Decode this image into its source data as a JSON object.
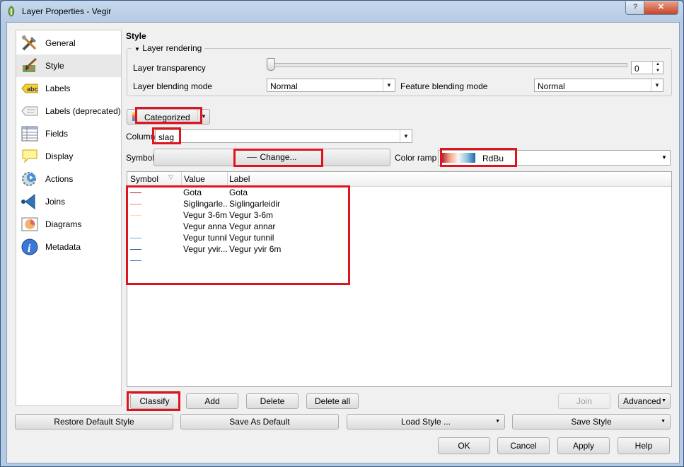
{
  "window": {
    "title": "Layer Properties - Vegir",
    "help_label": "?",
    "close_label": "✕"
  },
  "sidebar": {
    "items": [
      {
        "label": "General",
        "icon": "tools-icon"
      },
      {
        "label": "Style",
        "icon": "paintbrush-icon"
      },
      {
        "label": "Labels",
        "icon": "abc-icon"
      },
      {
        "label": "Labels (deprecated)",
        "icon": "label-deprecated-icon"
      },
      {
        "label": "Fields",
        "icon": "table-icon"
      },
      {
        "label": "Display",
        "icon": "speech-bubble-icon"
      },
      {
        "label": "Actions",
        "icon": "gear-play-icon"
      },
      {
        "label": "Joins",
        "icon": "join-arrow-icon"
      },
      {
        "label": "Diagrams",
        "icon": "chart-icon"
      },
      {
        "label": "Metadata",
        "icon": "info-icon"
      }
    ],
    "selected": "Style"
  },
  "style": {
    "heading": "Style",
    "rendering_group": "Layer rendering",
    "transparency_label": "Layer transparency",
    "transparency_value": "0",
    "transparency_level": 0,
    "layer_blending_label": "Layer blending mode",
    "layer_blending_value": "Normal",
    "feature_blending_label": "Feature blending mode",
    "feature_blending_value": "Normal",
    "renderer": "Categorized",
    "column_label": "Column",
    "column_value": "slag",
    "symbol_label": "Symbol",
    "change_label": "Change...",
    "color_ramp_label": "Color ramp",
    "color_ramp_value": "RdBu"
  },
  "table": {
    "headers": [
      "Symbol",
      "Value",
      "Label"
    ],
    "rows": [
      {
        "color": "#b2182b",
        "value": "Gota",
        "label": "Gota"
      },
      {
        "color": "#ef8a62",
        "value": "Siglingarle...",
        "label": "Siglingarleidir"
      },
      {
        "color": "#fddbc7",
        "value": "Vegur 3-6m",
        "label": "Vegur 3-6m"
      },
      {
        "color": "#f7f7f7",
        "value": "Vegur annar",
        "label": "Vegur annar"
      },
      {
        "color": "#67a9cf",
        "value": "Vegur tunnil",
        "label": "Vegur tunnil"
      },
      {
        "color": "#2166ac",
        "value": "Vegur yvir...",
        "label": "Vegur yvir 6m"
      },
      {
        "color": "#2166ac",
        "value": "",
        "label": ""
      }
    ]
  },
  "buttons": {
    "classify": "Classify",
    "add": "Add",
    "delete": "Delete",
    "delete_all": "Delete all",
    "join": "Join",
    "advanced": "Advanced",
    "restore_default": "Restore Default Style",
    "save_default": "Save As Default",
    "load_style": "Load Style ...",
    "save_style": "Save Style",
    "ok": "OK",
    "cancel": "Cancel",
    "apply": "Apply",
    "help": "Help"
  },
  "colors": {
    "highlight": "#e0141e",
    "selection": "#e8e8e8"
  }
}
